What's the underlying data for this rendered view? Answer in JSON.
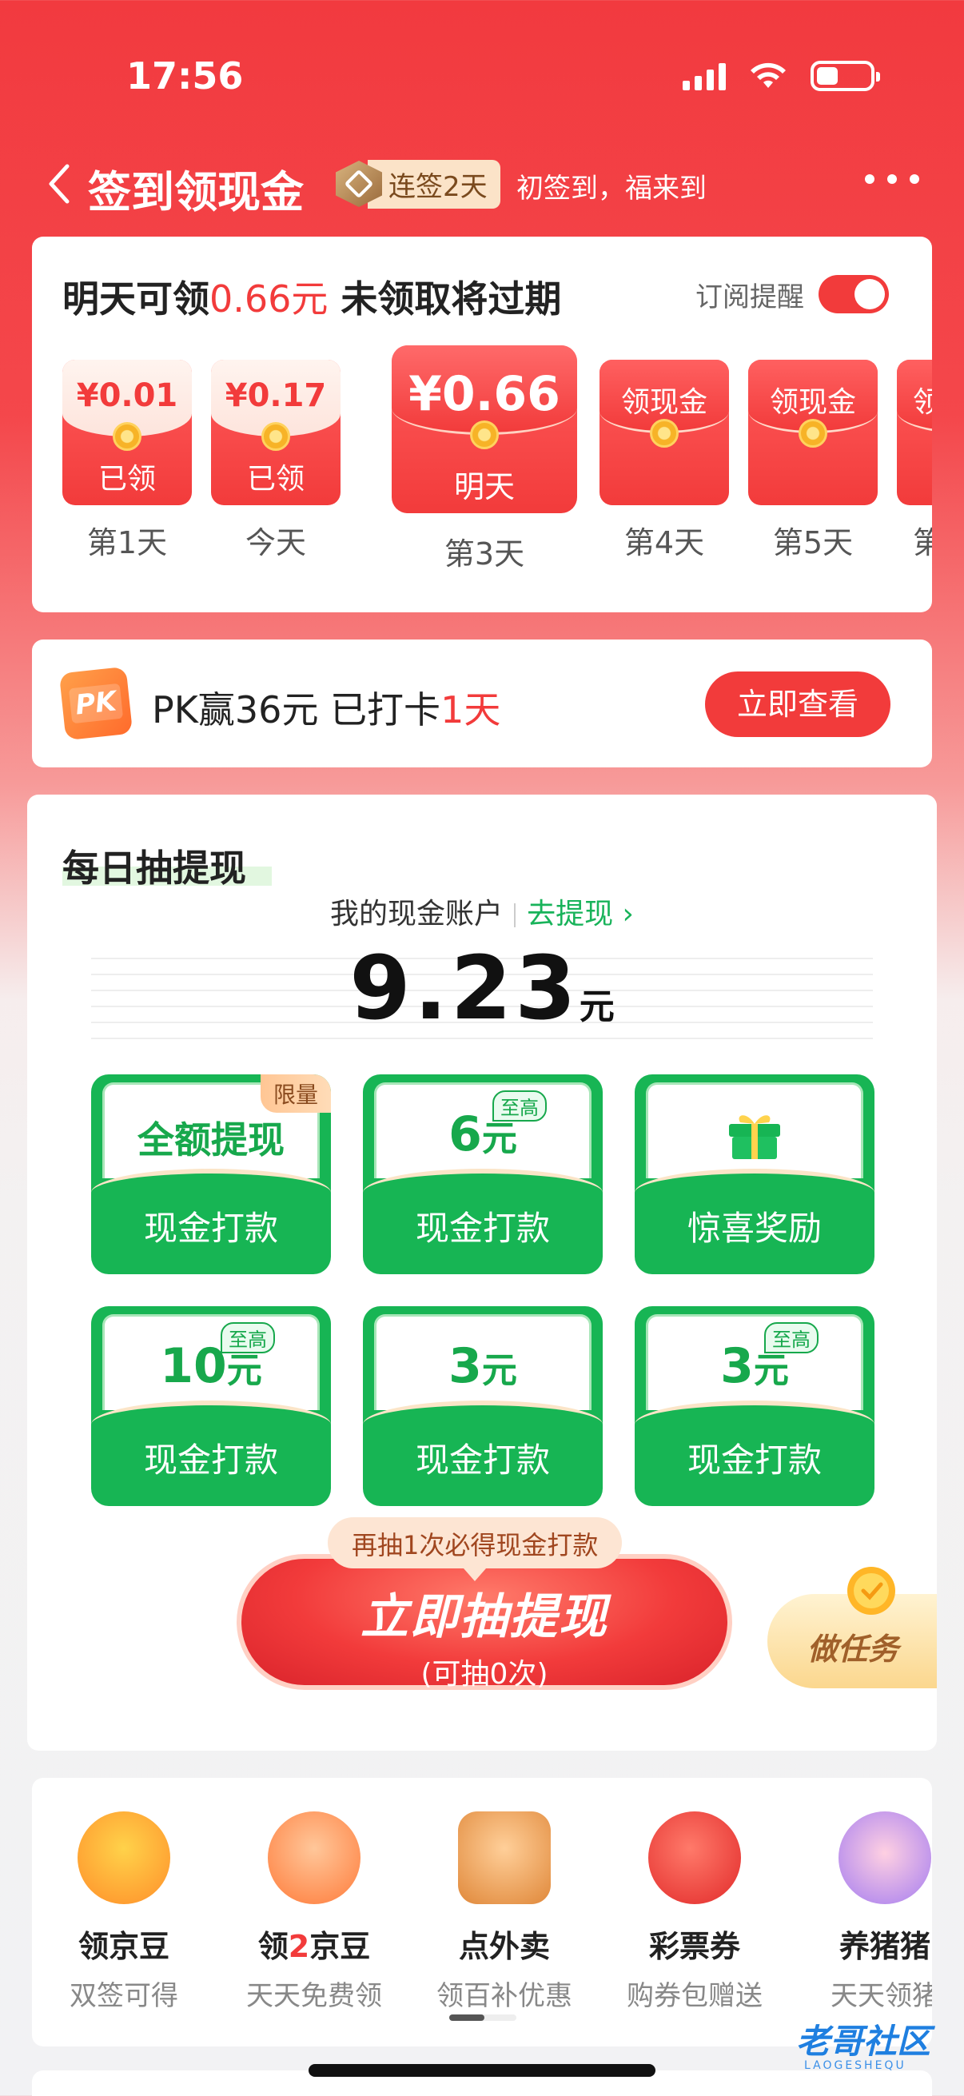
{
  "status_bar": {
    "time": "17:56"
  },
  "header": {
    "title": "签到领现金",
    "streak": "连签2天",
    "slogan": "初签到，福来到"
  },
  "signin": {
    "title_prefix": "明天可领",
    "title_amount": "0.66元",
    "title_suffix": " 未领取将过期",
    "remind_label": "订阅提醒",
    "remind_on": true,
    "days": [
      {
        "amount": "¥0.01",
        "state": "已领",
        "label": "第1天"
      },
      {
        "amount": "¥0.17",
        "state": "已领",
        "label": "今天"
      },
      {
        "amount": "¥0.66",
        "state": "明天",
        "label": "第3天"
      },
      {
        "amount": "领现金",
        "state": "",
        "label": "第4天"
      },
      {
        "amount": "领现金",
        "state": "",
        "label": "第5天"
      },
      {
        "amount": "领",
        "state": "",
        "label": "第"
      }
    ]
  },
  "pk": {
    "text_prefix": "PK赢36元 已打卡",
    "text_days": "1天",
    "button": "立即查看",
    "icon_text": "PK"
  },
  "draw": {
    "title": "每日抽提现",
    "account_label": "我的现金账户",
    "withdraw_link": "去提现",
    "balance": "9.23",
    "balance_unit": "元",
    "prizes": [
      {
        "big": "全额提现",
        "unit": "",
        "tag": "限量",
        "tag_type": "limit",
        "label": "现金打款"
      },
      {
        "big": "6",
        "unit": "元",
        "tag": "至高",
        "tag_type": "top",
        "label": "现金打款"
      },
      {
        "big": "",
        "unit": "",
        "tag": "",
        "tag_type": "gift",
        "label": "惊喜奖励"
      },
      {
        "big": "10",
        "unit": "元",
        "tag": "至高",
        "tag_type": "top",
        "label": "现金打款"
      },
      {
        "big": "3",
        "unit": "元",
        "tag": "",
        "tag_type": "none",
        "label": "现金打款"
      },
      {
        "big": "3",
        "unit": "元",
        "tag": "至高",
        "tag_type": "top",
        "label": "现金打款"
      }
    ],
    "tip": "再抽1次必得现金打款",
    "button_main": "立即抽提现",
    "button_sub": "(可抽0次)",
    "task_button": "做任务"
  },
  "services": [
    {
      "name_parts": [
        "领京豆"
      ],
      "desc": "双签可得",
      "icon": "duck-icon",
      "color": "#ff9b2f"
    },
    {
      "name_parts": [
        "领",
        "2",
        "京豆"
      ],
      "desc": "天天免费领",
      "icon": "bean-icon",
      "color": "#ff8a3d"
    },
    {
      "name_parts": [
        "点外卖"
      ],
      "desc": "领百补优惠",
      "icon": "takeout-bag-icon",
      "color": "#ffb36b"
    },
    {
      "name_parts": [
        "彩票券"
      ],
      "desc": "购券包赠送",
      "icon": "lottery-ball-icon",
      "color": "#ff5b4f"
    },
    {
      "name_parts": [
        "养猪猪"
      ],
      "desc": "天天领猪",
      "icon": "pig-icon",
      "color": "#ff9ec4"
    }
  ],
  "watermark": {
    "text": "老哥社区",
    "sub": "LAOGESHEQU"
  }
}
